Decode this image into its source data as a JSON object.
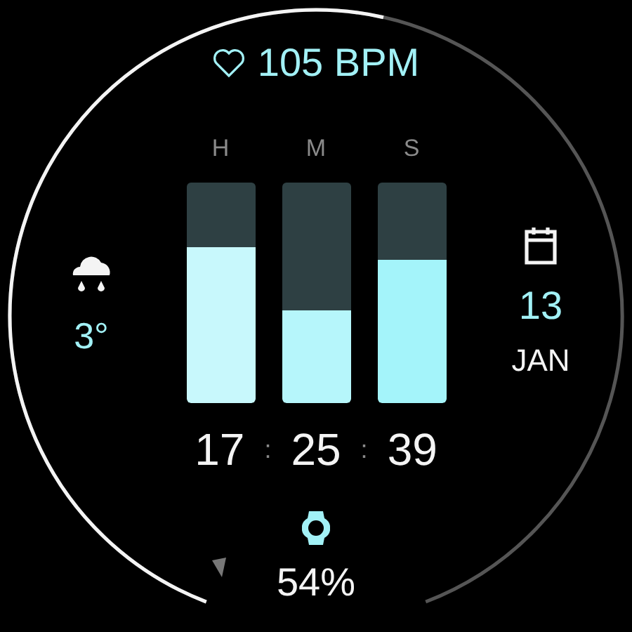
{
  "heart_rate": {
    "reading": "105 BPM"
  },
  "weather": {
    "temperature": "3°"
  },
  "columns": [
    {
      "label": "H",
      "level": 0.71,
      "color": "#c8f8fc"
    },
    {
      "label": "M",
      "level": 0.42,
      "color": "#b6f6fb"
    },
    {
      "label": "S",
      "level": 0.65,
      "color": "#a4f4fa"
    }
  ],
  "date": {
    "day": "13",
    "month": "JAN"
  },
  "time": {
    "hours": "17",
    "minutes": "25",
    "seconds": "39",
    "separators": [
      ":",
      ":"
    ]
  },
  "battery": {
    "reading": "54%"
  }
}
